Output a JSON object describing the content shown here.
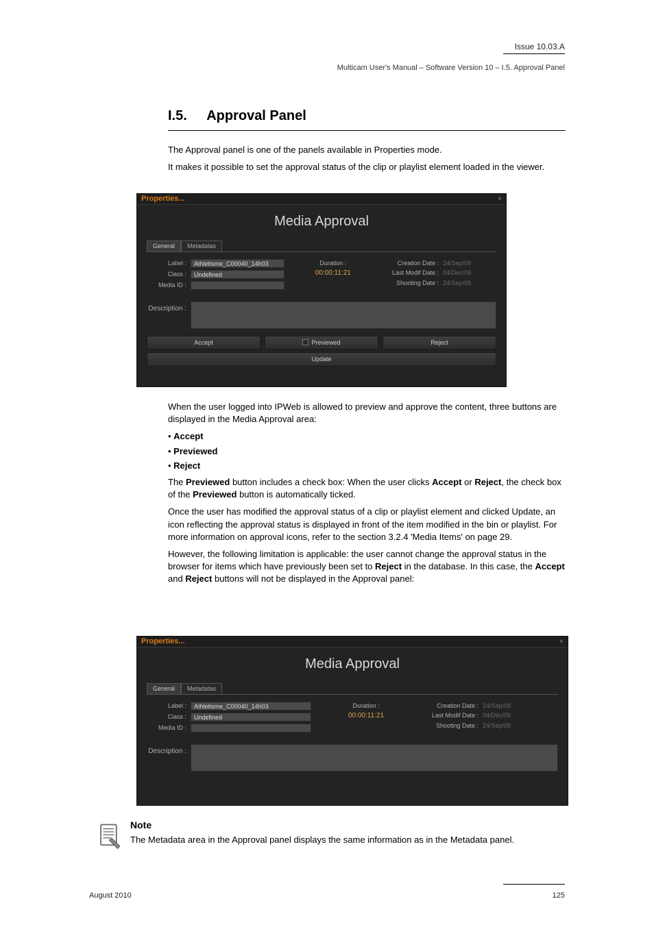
{
  "header": {
    "issue": "Issue 10.03.A",
    "title": "Multicam User's Manual – Software Version 10 – I.5. Approval Panel"
  },
  "chapter": {
    "number": "I.5.",
    "heading": "Approval Panel"
  },
  "intro": {
    "p1": "The Approval panel is one of the panels available in Properties mode.",
    "p2": "It makes it possible to set the approval status of the clip or playlist element loaded in the viewer."
  },
  "window": {
    "title": "Properties...",
    "close": "×",
    "panel_title": "Media Approval",
    "tabs": {
      "general": "General",
      "metadata": "Metadatas"
    },
    "labels": {
      "label": "Label :",
      "class": "Class :",
      "mediaid": "Media ID :",
      "duration": "Duration :",
      "description": "Description :",
      "creation": "Creation Date :",
      "lastmodif": "Last Modif Date :",
      "shooting": "Shooting Date :"
    },
    "values": {
      "label": "Athletisme_C00040_14h03",
      "class": "Undefined",
      "mediaid": "",
      "duration": "00:00:11:21",
      "creation": "24/Sep/09",
      "lastmodif": "04/Dec/09",
      "shooting": "24/Sep/09"
    },
    "buttons": {
      "accept": "Accept",
      "previewed": "Previewed",
      "reject": "Reject",
      "update": "Update"
    }
  },
  "midtext": {
    "p1": "When the user logged into IPWeb is allowed to preview and approve the content, three buttons are displayed in the Media Approval area:",
    "b_accept": "Accept",
    "b_previewed": "Previewed",
    "b_reject": "Reject",
    "p2": "The Previewed button includes a check box: When the user clicks Accept or Reject, the check box of the Previewed button is automatically ticked.",
    "p3": "Once the user has modified the approval status of a clip or playlist element and clicked Update, an icon reflecting the approval status is displayed in front of the item modified in the bin or playlist. For more information on approval icons, refer to the section 3.2.4 'Media Items' on page 29.",
    "p4": "However, the following limitation is applicable: the user cannot change the approval status in the browser for items which have previously been set to Reject in the database. In this case, the Accept and Reject buttons will not be displayed in the Approval panel:"
  },
  "note": {
    "title": "Note",
    "body": "The Metadata area in the Approval panel displays the same information as in the Metadata panel."
  },
  "footer": {
    "left": "August 2010",
    "right": "125"
  }
}
